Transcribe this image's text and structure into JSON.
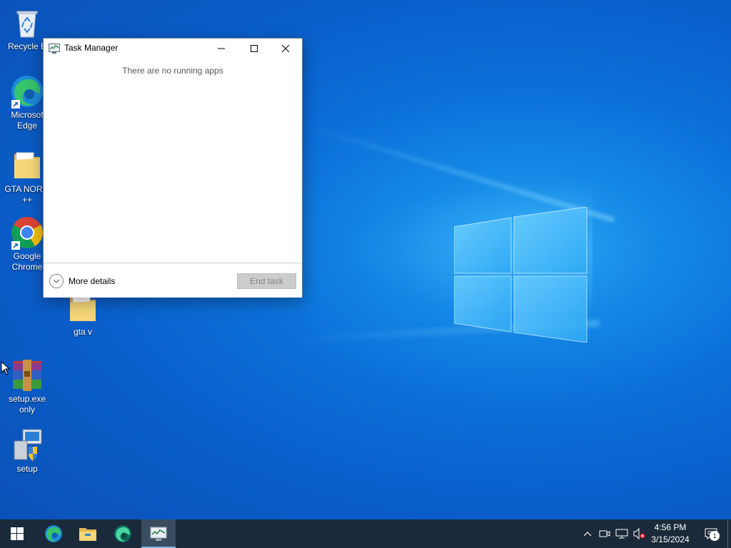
{
  "desktop": {
    "icons": [
      {
        "label": "Recycle B",
        "icon": "recycle-bin-icon"
      },
      {
        "label": "Microsoft Edge",
        "line1": "Microsof",
        "line2": "Edge",
        "icon": "edge-icon"
      },
      {
        "label": "GTA NORM ++",
        "line1": "GTA NORM",
        "line2": "++",
        "icon": "folder-icon"
      },
      {
        "label": "Google Chrome",
        "line1": "Google",
        "line2": "Chrome",
        "icon": "chrome-icon"
      },
      {
        "label": "gta v",
        "icon": "folder-icon"
      },
      {
        "label": "setup.exe only",
        "line1": "setup.exe",
        "line2": "only",
        "icon": "winrar-icon"
      },
      {
        "label": "setup",
        "icon": "setup-installer-icon"
      }
    ]
  },
  "task_manager": {
    "title": "Task Manager",
    "empty_message": "There are no running apps",
    "more_details_label": "More details",
    "end_task_label": "End task",
    "end_task_enabled": false
  },
  "taskbar": {
    "pinned": [
      {
        "name": "start",
        "icon": "windows-start-icon"
      },
      {
        "name": "edge",
        "icon": "edge-icon"
      },
      {
        "name": "file-explorer",
        "icon": "folder-icon"
      },
      {
        "name": "edge-dev",
        "icon": "edge-dev-icon"
      },
      {
        "name": "task-manager",
        "icon": "task-manager-icon",
        "active": true
      }
    ],
    "tray": {
      "time": "4:56 PM",
      "date": "3/15/2024",
      "notification_count": "1"
    }
  },
  "colors": {
    "taskbar_bg": "#1b2a3a",
    "desktop_blue": "#0b6fd9",
    "accent": "#7ab3e6"
  }
}
